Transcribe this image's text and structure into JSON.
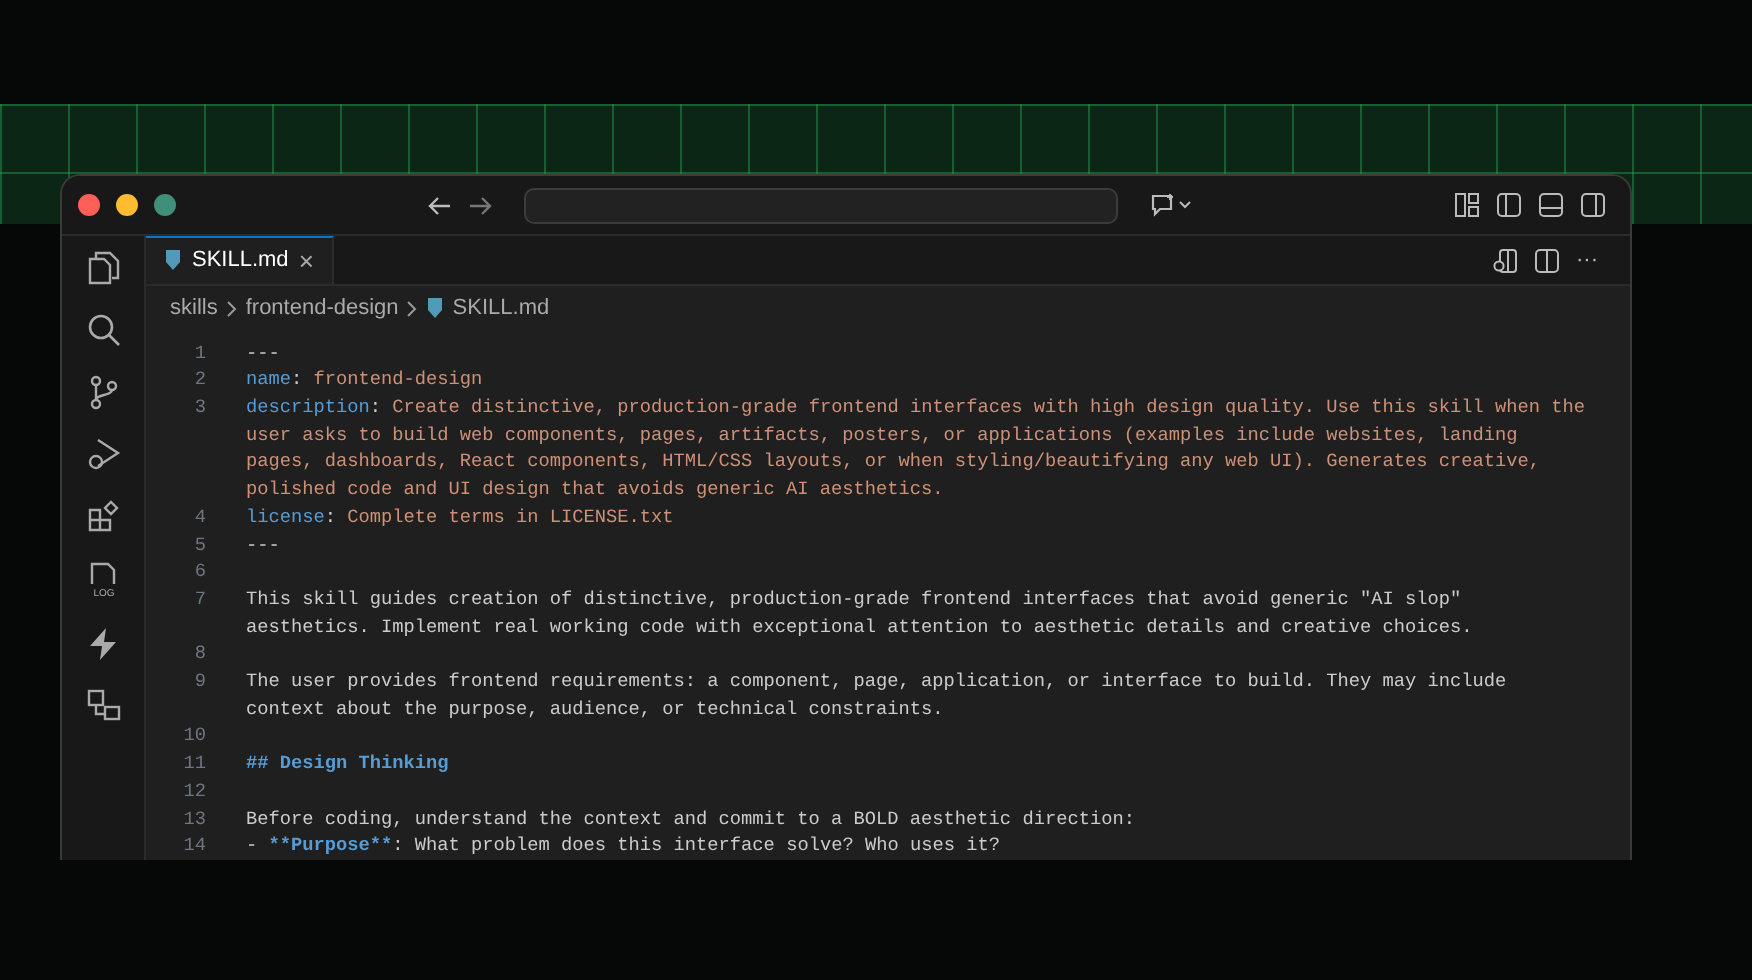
{
  "tab": {
    "label": "SKILL.md",
    "selected": true,
    "close": "×"
  },
  "breadcrumb": [
    "skills",
    "frontend-design",
    "SKILL.md"
  ],
  "more": "···",
  "log_icon_label": "LOG",
  "lines": [
    {
      "number": "1",
      "rows": [
        [
          {
            "kind": "plain",
            "text": "---"
          }
        ]
      ]
    },
    {
      "number": "2",
      "rows": [
        [
          {
            "kind": "key",
            "text": "name"
          },
          {
            "kind": "plain",
            "text": ": "
          },
          {
            "kind": "value",
            "text": "frontend-design"
          }
        ]
      ]
    },
    {
      "number": "3",
      "rows": [
        [
          {
            "kind": "key",
            "text": "description"
          },
          {
            "kind": "plain",
            "text": ": "
          },
          {
            "kind": "value",
            "text": "Create distinctive, production-grade frontend interfaces with high design quality. Use this skill when the"
          }
        ],
        [
          {
            "kind": "value",
            "text": "user asks to build web components, pages, artifacts, posters, or applications (examples include websites, landing"
          }
        ],
        [
          {
            "kind": "value",
            "text": "pages, dashboards, React components, HTML/CSS layouts, or when styling/beautifying any web UI). Generates creative,"
          }
        ],
        [
          {
            "kind": "value",
            "text": "polished code and UI design that avoids generic AI aesthetics."
          }
        ]
      ]
    },
    {
      "number": "4",
      "rows": [
        [
          {
            "kind": "key",
            "text": "license"
          },
          {
            "kind": "plain",
            "text": ": "
          },
          {
            "kind": "value",
            "text": "Complete terms in LICENSE.txt"
          }
        ]
      ]
    },
    {
      "number": "5",
      "rows": [
        [
          {
            "kind": "plain",
            "text": "---"
          }
        ]
      ]
    },
    {
      "number": "6",
      "rows": [
        []
      ]
    },
    {
      "number": "7",
      "rows": [
        [
          {
            "kind": "plain",
            "text": "This skill guides creation of distinctive, production-grade frontend interfaces that avoid generic \"AI slop\""
          }
        ],
        [
          {
            "kind": "plain",
            "text": "aesthetics. Implement real working code with exceptional attention to aesthetic details and creative choices."
          }
        ]
      ]
    },
    {
      "number": "8",
      "rows": [
        []
      ]
    },
    {
      "number": "9",
      "rows": [
        [
          {
            "kind": "plain",
            "text": "The user provides frontend requirements: a component, page, application, or interface to build. They may include"
          }
        ],
        [
          {
            "kind": "plain",
            "text": "context about the purpose, audience, or technical constraints."
          }
        ]
      ]
    },
    {
      "number": "10",
      "rows": [
        []
      ]
    },
    {
      "number": "11",
      "rows": [
        [
          {
            "kind": "heading",
            "text": "## Design Thinking"
          }
        ]
      ]
    },
    {
      "number": "12",
      "rows": [
        []
      ]
    },
    {
      "number": "13",
      "rows": [
        [
          {
            "kind": "plain",
            "text": "Before coding, understand the context and commit to a BOLD aesthetic direction:"
          }
        ]
      ]
    },
    {
      "number": "14",
      "rows": [
        [
          {
            "kind": "plain",
            "text": "- "
          },
          {
            "kind": "strong",
            "text": "**Purpose**"
          },
          {
            "kind": "plain",
            "text": ": What problem does this interface solve? Who uses it?"
          }
        ]
      ]
    }
  ]
}
